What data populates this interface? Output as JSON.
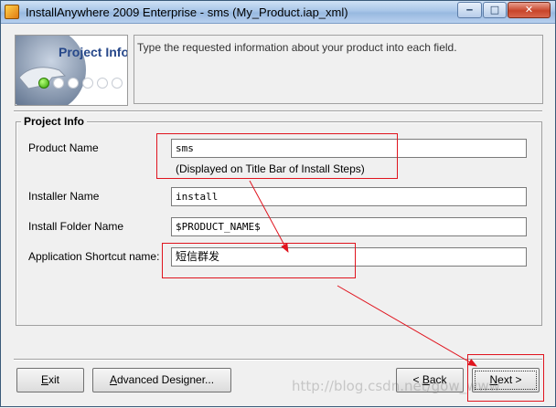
{
  "window": {
    "title": "InstallAnywhere 2009 Enterprise - sms (My_Product.iap_xml)",
    "controls": {
      "minimize": "‒",
      "maximize": "□",
      "close": "✕"
    }
  },
  "header": {
    "image_title": "Project Info",
    "description": "Type the requested information about your product into each field."
  },
  "group": {
    "title": "Project Info",
    "fields": [
      {
        "label": "Product Name",
        "value": "sms"
      },
      {
        "label": "Installer Name",
        "value": "install"
      },
      {
        "label": "Install Folder Name",
        "value": "$PRODUCT_NAME$"
      },
      {
        "label": "Application Shortcut name:",
        "value": "短信群发"
      }
    ],
    "product_hint": "(Displayed on Title Bar of Install Steps)"
  },
  "buttons": {
    "exit": {
      "mnemonic": "E",
      "rest": "xit"
    },
    "advanced": {
      "mnemonic": "A",
      "rest": "dvanced Designer..."
    },
    "back": {
      "prefix": "< ",
      "mnemonic": "B",
      "rest": "ack"
    },
    "next": {
      "mnemonic": "N",
      "rest": "ext >"
    }
  },
  "watermark": "http://blog.csdn.net/gow_www",
  "colors": {
    "annotation": "#e0141e",
    "title_accent": "#27488a"
  }
}
